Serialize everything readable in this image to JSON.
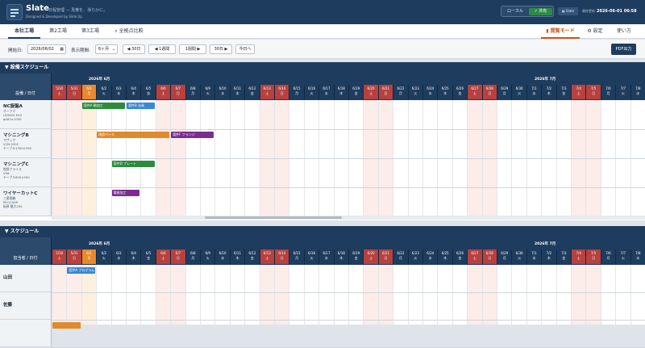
{
  "header": {
    "app_name": "Slate",
    "tagline": "日程管理 — 見権を、滑らかに。",
    "subtitle": "Designed & Developed by Slide Up",
    "mode_local": "ローカル",
    "mode_shared": "✓ 共有",
    "slate_btn": "Slate",
    "updated_label": "最終更新",
    "updated_value": "2026-06-01 06:58"
  },
  "tabs": [
    "本社工場",
    "第2工場",
    "第3工場",
    "全拠点比較"
  ],
  "right_tabs": {
    "inspect": "閲覧モード",
    "settings": "設定",
    "howto": "使い方"
  },
  "toolbar": {
    "start_label": "開始日:",
    "start_value": "2026/06/02",
    "period_label": "表示期間:",
    "period_value": "6ヶ月",
    "back30": "◀ 30日",
    "back7": "◀ 1週間",
    "fwd7": "1週間 ▶",
    "fwd30": "30日 ▶",
    "today": "今日へ",
    "pdf": "PDF出力"
  },
  "colors": {
    "navy": "#1e3c5e",
    "weekend": "#b6413f",
    "today": "#e8892c",
    "green": "#2e8b3e",
    "blue": "#3a86d4",
    "orange": "#e08a2c",
    "purple": "#7b2d8f"
  },
  "timeline": {
    "months": [
      "2026年 6月",
      "2026年 7月"
    ],
    "days": [
      {
        "d": "5/30",
        "w": "土",
        "k": "we"
      },
      {
        "d": "5/31",
        "w": "日",
        "k": "we"
      },
      {
        "d": "6/1",
        "w": "月",
        "k": "today"
      },
      {
        "d": "6/2",
        "w": "火",
        "k": ""
      },
      {
        "d": "6/3",
        "w": "水",
        "k": ""
      },
      {
        "d": "6/4",
        "w": "木",
        "k": ""
      },
      {
        "d": "6/5",
        "w": "金",
        "k": ""
      },
      {
        "d": "6/6",
        "w": "土",
        "k": "we"
      },
      {
        "d": "6/7",
        "w": "日",
        "k": "we"
      },
      {
        "d": "6/8",
        "w": "月",
        "k": ""
      },
      {
        "d": "6/9",
        "w": "火",
        "k": ""
      },
      {
        "d": "6/10",
        "w": "水",
        "k": ""
      },
      {
        "d": "6/11",
        "w": "木",
        "k": ""
      },
      {
        "d": "6/12",
        "w": "金",
        "k": ""
      },
      {
        "d": "6/13",
        "w": "土",
        "k": "we"
      },
      {
        "d": "6/14",
        "w": "日",
        "k": "we"
      },
      {
        "d": "6/15",
        "w": "月",
        "k": ""
      },
      {
        "d": "6/16",
        "w": "火",
        "k": ""
      },
      {
        "d": "6/17",
        "w": "水",
        "k": ""
      },
      {
        "d": "6/18",
        "w": "木",
        "k": ""
      },
      {
        "d": "6/19",
        "w": "金",
        "k": ""
      },
      {
        "d": "6/20",
        "w": "土",
        "k": "we"
      },
      {
        "d": "6/21",
        "w": "日",
        "k": "we"
      },
      {
        "d": "6/22",
        "w": "月",
        "k": ""
      },
      {
        "d": "6/23",
        "w": "火",
        "k": ""
      },
      {
        "d": "6/24",
        "w": "水",
        "k": ""
      },
      {
        "d": "6/25",
        "w": "木",
        "k": ""
      },
      {
        "d": "6/26",
        "w": "金",
        "k": ""
      },
      {
        "d": "6/27",
        "w": "土",
        "k": "we"
      },
      {
        "d": "6/28",
        "w": "日",
        "k": "we"
      },
      {
        "d": "6/29",
        "w": "月",
        "k": ""
      },
      {
        "d": "6/30",
        "w": "火",
        "k": ""
      },
      {
        "d": "7/1",
        "w": "水",
        "k": ""
      },
      {
        "d": "7/2",
        "w": "木",
        "k": ""
      },
      {
        "d": "7/3",
        "w": "金",
        "k": ""
      },
      {
        "d": "7/4",
        "w": "土",
        "k": "we"
      },
      {
        "d": "7/5",
        "w": "日",
        "k": "we"
      },
      {
        "d": "7/6",
        "w": "月",
        "k": ""
      },
      {
        "d": "7/7",
        "w": "火",
        "k": ""
      },
      {
        "d": "7/8",
        "w": "水",
        "k": ""
      }
    ]
  },
  "equipment": {
    "title": "▼ 設備スケジュール",
    "corner": "設備 / 日付",
    "rows": [
      {
        "name": "NC旋盤A",
        "lines": [
          "オークマ",
          "LB3000 EXII",
          "φ400×1000"
        ],
        "bars": [
          {
            "start": 2,
            "len": 3,
            "label": "案件A 軸加工",
            "color": "green"
          },
          {
            "start": 5,
            "len": 2,
            "label": "案件B 治具",
            "color": "blue"
          }
        ]
      },
      {
        "name": "マシニングB",
        "lines": [
          "マザック",
          "VCN-530C",
          "テーブル1300×550"
        ],
        "bars": [
          {
            "start": 3,
            "len": 5,
            "label": "改造ベース",
            "color": "orange"
          },
          {
            "start": 8,
            "len": 3,
            "label": "案件F フランジ",
            "color": "purple"
          }
        ]
      },
      {
        "name": "マシニングC",
        "lines": [
          "牧野フライス",
          "V56",
          "テーブル800×500"
        ],
        "bars": [
          {
            "start": 4,
            "len": 3,
            "label": "案件D プレート",
            "color": "green"
          }
        ]
      },
      {
        "name": "ワイヤーカットC",
        "lines": [
          "三菱電機",
          "MV1200R",
          "板厚 最大295"
        ],
        "bars": [
          {
            "start": 4,
            "len": 2,
            "label": "電極加工",
            "color": "purple"
          }
        ]
      }
    ]
  },
  "people": {
    "title": "▼ スケジュール",
    "corner": "担当者 / 日付",
    "rows": [
      {
        "name": "山田",
        "bars": [
          {
            "start": 1,
            "len": 2,
            "label": "案件A プログラム",
            "color": "blue"
          }
        ]
      },
      {
        "name": "佐藤",
        "bars": []
      },
      {
        "name": "",
        "bars": [
          {
            "start": 0,
            "len": 2,
            "label": "",
            "color": "orange"
          }
        ]
      }
    ]
  }
}
